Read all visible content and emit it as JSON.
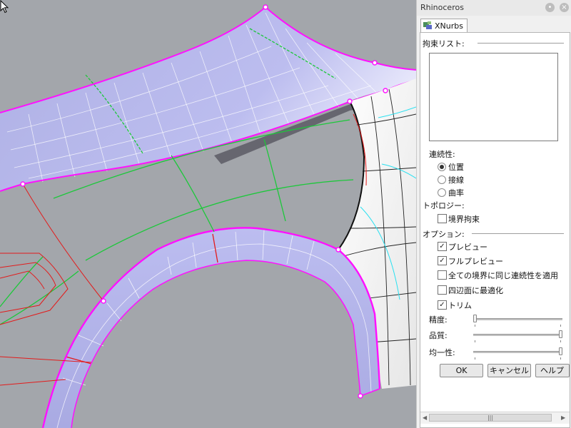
{
  "panel": {
    "title": "Rhinoceros",
    "tab_label": "XNurbs",
    "constraint_list_label": "拘束リスト:",
    "continuity_label": "連続性:",
    "continuity_options": [
      "位置",
      "接線",
      "曲率"
    ],
    "continuity_selected": "位置",
    "topology_label": "トポロジー:",
    "boundary_constraint_label": "境界拘束",
    "boundary_constraint_checked": false,
    "options_label": "オプション:",
    "preview_label": "プレビュー",
    "preview_checked": true,
    "full_preview_label": "フルプレビュー",
    "full_preview_checked": true,
    "same_continuity_label": "全ての境界に同じ連続性を適用",
    "same_continuity_checked": false,
    "quad_optimize_label": "四辺面に最適化",
    "quad_optimize_checked": false,
    "trim_label": "トリム",
    "trim_checked": true,
    "precision_label": "精度:",
    "precision_value": 0,
    "quality_label": "品質:",
    "quality_value": 1,
    "uniformity_label": "均一性:",
    "uniformity_value": 1,
    "ok_label": "OK",
    "cancel_label": "キャンセル",
    "help_label": "ヘルプ"
  },
  "colors": {
    "viewport_bg": "#a3a6ab",
    "surface_fill": "#b4b5e8",
    "edge_magenta": "#ff10ff",
    "curve_green": "#1cc83a",
    "curve_red": "#e31b1b",
    "iso_cyan": "#28e0f0"
  }
}
